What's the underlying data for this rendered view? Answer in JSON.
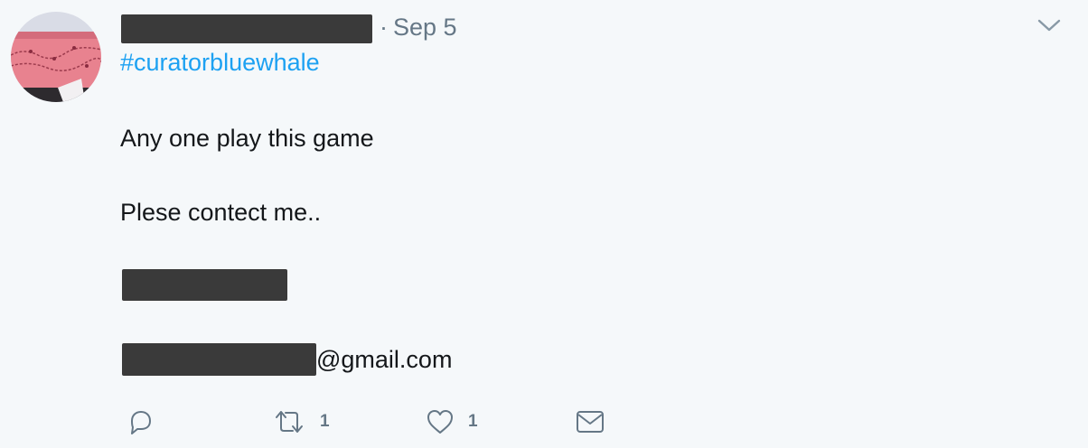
{
  "tweet": {
    "separator": "·",
    "date": "Sep 5",
    "hashtag": "#curatorbluewhale",
    "lines": [
      "Any one play this game",
      "Plese contect me.."
    ],
    "email_suffix": "@gmail.com"
  },
  "actions": {
    "reply": {
      "icon": "reply-icon",
      "count": ""
    },
    "retweet": {
      "icon": "retweet-icon",
      "count": "1"
    },
    "like": {
      "icon": "heart-icon",
      "count": "1"
    },
    "dm": {
      "icon": "envelope-icon",
      "count": ""
    }
  },
  "colors": {
    "background": "#f5f8fa",
    "hashtag": "#1da1f2",
    "muted": "#657786",
    "redaction": "#3a3a3a"
  }
}
